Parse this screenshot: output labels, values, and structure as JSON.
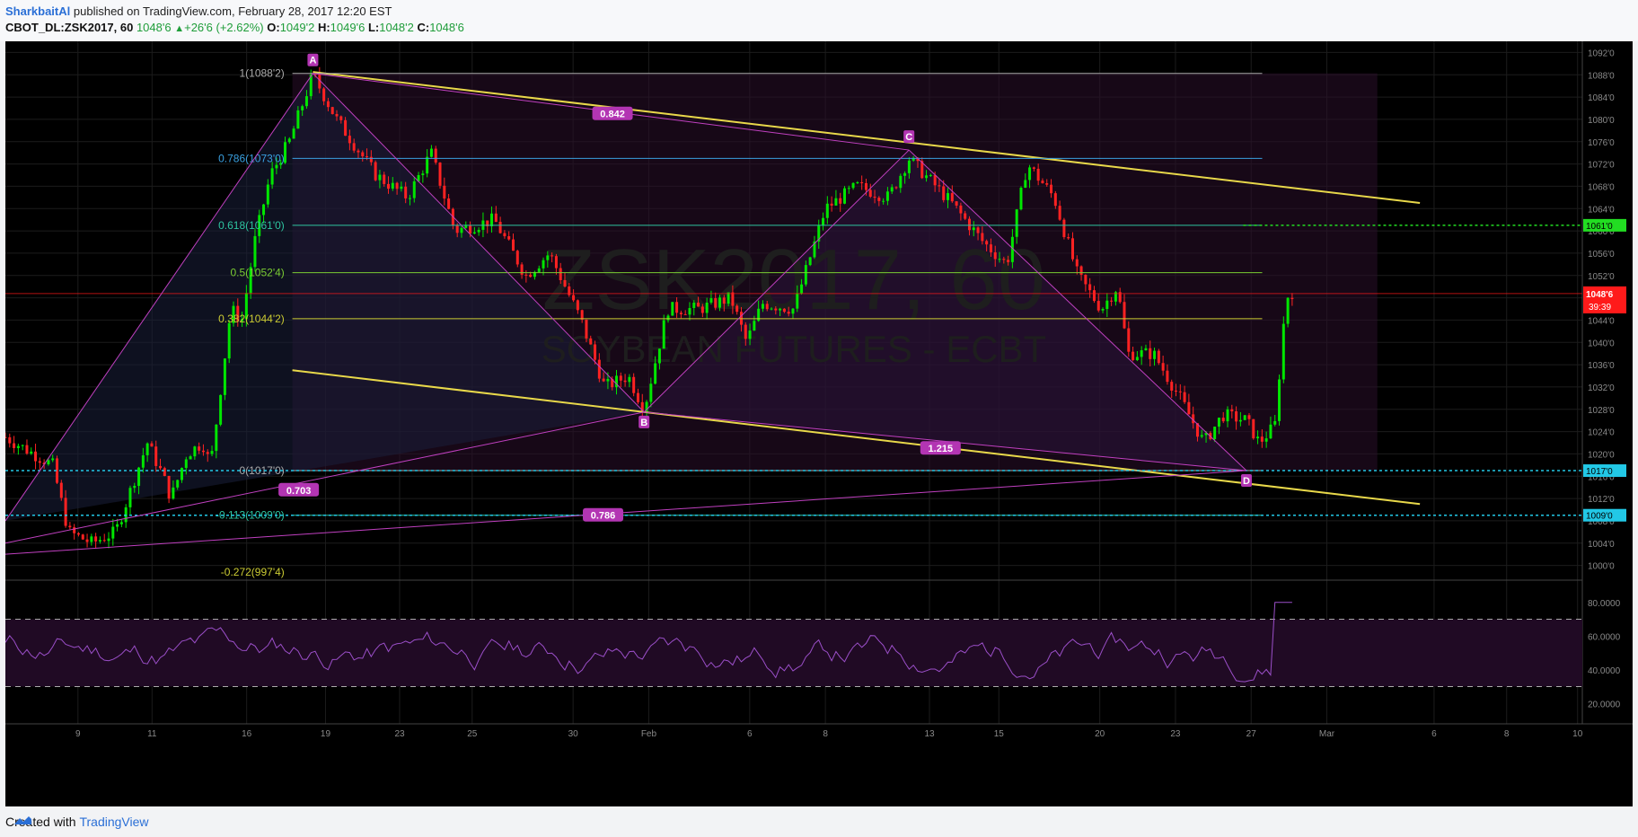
{
  "header": {
    "author": "SharkbaitAl",
    "published_text": "published on TradingView.com, February 28, 2017 12:20 EST",
    "symbol": "CBOT_DL:ZSK2017, 60",
    "last": "1048'6",
    "change": "+26'6 (+2.62%)",
    "o_label": "O:",
    "o_value": "1049'2",
    "h_label": "H:",
    "h_value": "1049'6",
    "l_label": "L:",
    "l_value": "1048'2",
    "c_label": "C:",
    "c_value": "1048'6"
  },
  "footer": {
    "created_with": "Created with",
    "brand": "TradingView"
  },
  "colors": {
    "background": "#000000",
    "up": "#00e600",
    "down": "#ff2222",
    "channel": "#e8d84a",
    "pattern": "#c040c0",
    "rsi": "#9b4fc9",
    "price_label": "#ff1a1a",
    "cyan": "#22c8e6",
    "green_level": "#22dd22"
  },
  "chart_data": {
    "type": "candlestick",
    "watermark_symbol": "ZSK2017, 60",
    "watermark_name": "SOYBEAN FUTURES - ECBT",
    "y_axis_ticks": [
      "1092'0",
      "1088'0",
      "1084'0",
      "1080'0",
      "1076'0",
      "1072'0",
      "1068'0",
      "1064'0",
      "1060'0",
      "1056'0",
      "1052'0",
      "1048'0",
      "1044'0",
      "1040'0",
      "1036'0",
      "1032'0",
      "1028'0",
      "1024'0",
      "1020'0",
      "1016'0",
      "1012'0",
      "1008'0",
      "1004'0",
      "1000'0"
    ],
    "y_axis_values": [
      1092,
      1088,
      1084,
      1080,
      1076,
      1072,
      1068,
      1064,
      1060,
      1056,
      1052,
      1048,
      1044,
      1040,
      1036,
      1032,
      1028,
      1024,
      1020,
      1016,
      1012,
      1008,
      1004,
      1000
    ],
    "ylim": [
      998,
      1094
    ],
    "x_axis_ticks": [
      "9",
      "11",
      "16",
      "19",
      "23",
      "25",
      "30",
      "Feb",
      "6",
      "8",
      "13",
      "15",
      "20",
      "23",
      "27",
      "Mar",
      "6",
      "8",
      "10"
    ],
    "x_axis_positions": [
      0.046,
      0.093,
      0.153,
      0.203,
      0.25,
      0.296,
      0.36,
      0.408,
      0.472,
      0.52,
      0.586,
      0.63,
      0.694,
      0.742,
      0.79,
      0.838,
      0.906,
      0.952,
      0.997
    ],
    "last_price_label": "1048'6",
    "countdown_label": "39:39",
    "last_price": 1048.75,
    "fib_levels": [
      {
        "label": "1(1088'2)",
        "value": 1088.25,
        "color": "#aaaaaa"
      },
      {
        "label": "0.786(1073'0)",
        "value": 1073.0,
        "color": "#3aa0e0"
      },
      {
        "label": "0.618(1061'0)",
        "value": 1061.0,
        "color": "#2ec4a0"
      },
      {
        "label": "0.5(1052'4)",
        "value": 1052.5,
        "color": "#7acc33"
      },
      {
        "label": "0.382(1044'2)",
        "value": 1044.25,
        "color": "#cccc33"
      },
      {
        "label": "0(1017'0)",
        "value": 1017.0,
        "color": "#aaaaaa"
      },
      {
        "label": "-0.113(1009'0)",
        "value": 1009.0,
        "color": "#2ec4a0"
      },
      {
        "label": "-0.272(997'4)",
        "value": 997.5,
        "color": "#cccc33"
      }
    ],
    "level_labels": [
      {
        "label": "1061'0",
        "value": 1061.0,
        "color": "#22dd22"
      },
      {
        "label": "1017'0",
        "value": 1017.0,
        "color": "#22c8e6"
      },
      {
        "label": "1009'0",
        "value": 1009.0,
        "color": "#22c8e6"
      }
    ],
    "pattern_points": [
      {
        "label": "A",
        "x": 0.195,
        "value": 1088.25
      },
      {
        "label": "B",
        "x": 0.405,
        "value": 1027.5
      },
      {
        "label": "C",
        "x": 0.573,
        "value": 1074.5
      },
      {
        "label": "D",
        "x": 0.787,
        "value": 1017.0
      }
    ],
    "pattern_ratios": [
      {
        "label": "0.842",
        "x": 0.385,
        "value": 1081.0
      },
      {
        "label": "1.215",
        "x": 0.593,
        "value": 1021.0
      },
      {
        "label": "0.703",
        "x": 0.186,
        "value": 1013.5
      },
      {
        "label": "0.786",
        "x": 0.379,
        "value": 1009.0
      }
    ],
    "rsi_axis_ticks": [
      "80.0000",
      "60.0000",
      "40.0000",
      "20.0000"
    ],
    "rsi_axis_values": [
      80,
      60,
      40,
      20
    ],
    "rsi_upper": 70,
    "rsi_lower": 30,
    "grid": true
  }
}
